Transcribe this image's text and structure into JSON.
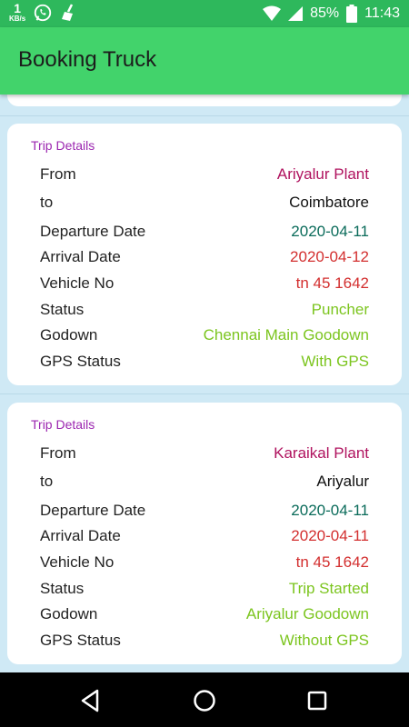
{
  "status_bar": {
    "speed_value": "1",
    "speed_unit": "KB/s",
    "battery": "85%",
    "time": "11:43"
  },
  "app_bar": {
    "title": "Booking Truck"
  },
  "labels": {
    "section": "Trip Details",
    "from": "From",
    "to": "to",
    "departure": "Departure Date",
    "arrival": "Arrival Date",
    "vehicle": "Vehicle No",
    "status": "Status",
    "godown": "Godown",
    "gps": "GPS Status"
  },
  "trips": [
    {
      "from": "Ariyalur Plant",
      "to": "Coimbatore",
      "departure_date": "2020-04-11",
      "arrival_date": "2020-04-12",
      "vehicle_no": "tn 45 1642",
      "status": "Puncher",
      "godown": "Chennai Main Goodown",
      "gps_status": "With GPS"
    },
    {
      "from": "Karaikal Plant",
      "to": "Ariyalur",
      "departure_date": "2020-04-11",
      "arrival_date": "2020-04-11",
      "vehicle_no": "tn 45 1642",
      "status": "Trip Started",
      "godown": "Ariyalur Goodown",
      "gps_status": "Without GPS"
    }
  ],
  "colors": {
    "status_bar": "#2eb85c",
    "app_bar": "#42d36b",
    "background": "#cfe9f5",
    "section_title": "#9c27b0"
  }
}
